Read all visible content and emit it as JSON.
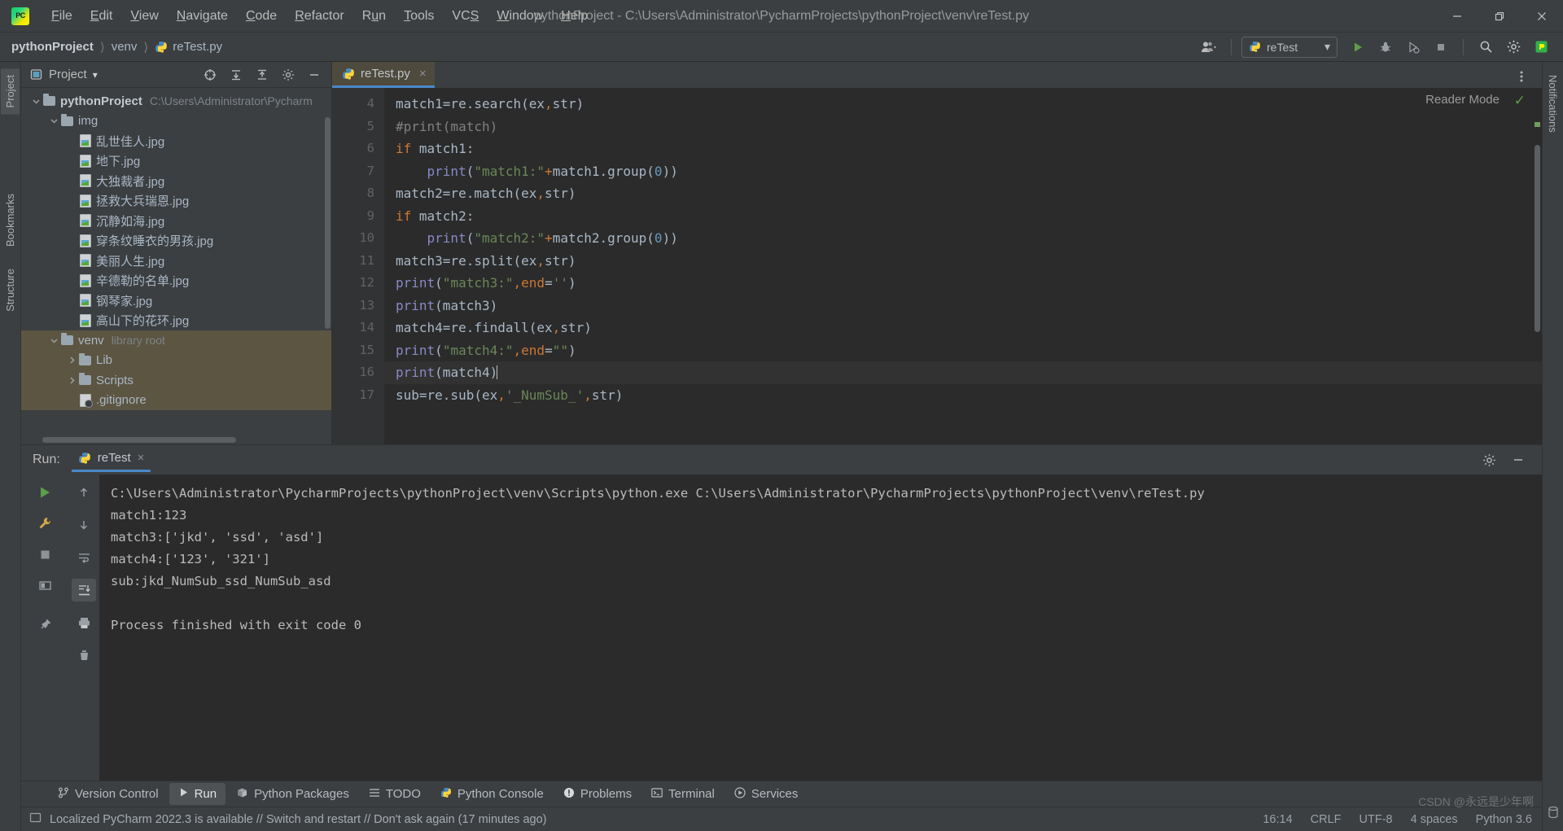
{
  "titlebar": {
    "logo_text": "PC",
    "window_title": "pythonProject - C:\\Users\\Administrator\\PycharmProjects\\pythonProject\\venv\\reTest.py",
    "menu": [
      {
        "label": "File",
        "mnemonic": "F"
      },
      {
        "label": "Edit",
        "mnemonic": "E"
      },
      {
        "label": "View",
        "mnemonic": "V"
      },
      {
        "label": "Navigate",
        "mnemonic": "N"
      },
      {
        "label": "Code",
        "mnemonic": "C"
      },
      {
        "label": "Refactor",
        "mnemonic": "R"
      },
      {
        "label": "Run",
        "mnemonic": "u"
      },
      {
        "label": "Tools",
        "mnemonic": "T"
      },
      {
        "label": "VCS",
        "mnemonic": "S"
      },
      {
        "label": "Window",
        "mnemonic": "W"
      },
      {
        "label": "Help",
        "mnemonic": "H"
      }
    ],
    "controls": {
      "minimize": "minimize-icon",
      "maximize": "restore-icon",
      "close": "close-icon"
    }
  },
  "navbar": {
    "breadcrumb": [
      {
        "label": "pythonProject",
        "bold": true
      },
      {
        "label": "venv",
        "bold": false
      },
      {
        "label": "reTest.py",
        "bold": false,
        "icon": "python-file-icon"
      }
    ],
    "separator": "〉",
    "run_config": {
      "label": "reTest",
      "icon": "python-icon",
      "chevron": "▾"
    },
    "buttons": [
      {
        "name": "run-button",
        "icon": "play-icon",
        "color": "#5c9f4a"
      },
      {
        "name": "debug-button",
        "icon": "bug-icon"
      },
      {
        "name": "run-with-coverage-button",
        "icon": "coverage-icon"
      },
      {
        "name": "stop-button",
        "icon": "stop-icon"
      },
      {
        "name": "search-everywhere-button",
        "icon": "search-icon"
      },
      {
        "name": "settings-button",
        "icon": "gear-icon"
      },
      {
        "name": "ide-assistant-button",
        "icon": "pycharm-badge-icon"
      }
    ],
    "account_icon": "user-account-icon"
  },
  "left_strip": {
    "tabs": [
      {
        "label": "Project",
        "active": true
      },
      {
        "label": "Bookmarks",
        "active": false
      },
      {
        "label": "Structure",
        "active": false
      }
    ]
  },
  "right_strip": {
    "tabs": [
      {
        "label": "Notifications",
        "active": false
      }
    ]
  },
  "project_panel": {
    "title": "Project",
    "title_icon": "project-icon",
    "chevron": "▾",
    "header_icons": [
      {
        "name": "select-opened-file-icon",
        "glyph": "⊕"
      },
      {
        "name": "expand-all-icon",
        "glyph": "⤓"
      },
      {
        "name": "collapse-all-icon",
        "glyph": "⤒"
      },
      {
        "name": "panel-settings-icon",
        "glyph": "⚙"
      },
      {
        "name": "hide-panel-icon",
        "glyph": "−"
      }
    ],
    "tree": [
      {
        "label": "pythonProject",
        "hint": "C:\\Users\\Administrator\\Pycharm",
        "indent": 0,
        "type": "folder",
        "arrow": "down",
        "bold": true,
        "selected": false
      },
      {
        "label": "img",
        "hint": "",
        "indent": 1,
        "type": "folder",
        "arrow": "down",
        "bold": false,
        "selected": false
      },
      {
        "label": "乱世佳人.jpg",
        "hint": "",
        "indent": 2,
        "type": "image",
        "arrow": "",
        "bold": false,
        "selected": false
      },
      {
        "label": "地下.jpg",
        "hint": "",
        "indent": 2,
        "type": "image",
        "arrow": "",
        "bold": false,
        "selected": false
      },
      {
        "label": "大独裁者.jpg",
        "hint": "",
        "indent": 2,
        "type": "image",
        "arrow": "",
        "bold": false,
        "selected": false
      },
      {
        "label": "拯救大兵瑞恩.jpg",
        "hint": "",
        "indent": 2,
        "type": "image",
        "arrow": "",
        "bold": false,
        "selected": false
      },
      {
        "label": "沉静如海.jpg",
        "hint": "",
        "indent": 2,
        "type": "image",
        "arrow": "",
        "bold": false,
        "selected": false
      },
      {
        "label": "穿条纹睡衣的男孩.jpg",
        "hint": "",
        "indent": 2,
        "type": "image",
        "arrow": "",
        "bold": false,
        "selected": false
      },
      {
        "label": "美丽人生.jpg",
        "hint": "",
        "indent": 2,
        "type": "image",
        "arrow": "",
        "bold": false,
        "selected": false
      },
      {
        "label": "辛德勒的名单.jpg",
        "hint": "",
        "indent": 2,
        "type": "image",
        "arrow": "",
        "bold": false,
        "selected": false
      },
      {
        "label": "钢琴家.jpg",
        "hint": "",
        "indent": 2,
        "type": "image",
        "arrow": "",
        "bold": false,
        "selected": false
      },
      {
        "label": "高山下的花环.jpg",
        "hint": "",
        "indent": 2,
        "type": "image",
        "arrow": "",
        "bold": false,
        "selected": false
      },
      {
        "label": "venv",
        "hint": "library root",
        "indent": 1,
        "type": "folder",
        "arrow": "down",
        "bold": false,
        "selected": true
      },
      {
        "label": "Lib",
        "hint": "",
        "indent": 2,
        "type": "folder",
        "arrow": "right",
        "bold": false,
        "selected": true
      },
      {
        "label": "Scripts",
        "hint": "",
        "indent": 2,
        "type": "folder",
        "arrow": "right",
        "bold": false,
        "selected": true
      },
      {
        "label": ".gitignore",
        "hint": "",
        "indent": 2,
        "type": "gitignore",
        "arrow": "",
        "bold": false,
        "selected": true
      }
    ]
  },
  "editor": {
    "tab": {
      "label": "reTest.py",
      "icon": "python-file-icon",
      "close": "×"
    },
    "tab_right_icon": "more-options-icon",
    "reader_mode": "Reader Mode",
    "reader_check": "✓",
    "first_line_number": 4,
    "current_line": 16,
    "lines": [
      {
        "n": 4,
        "text": "match1=re.search(ex,str)"
      },
      {
        "n": 5,
        "text": "#print(match)"
      },
      {
        "n": 6,
        "text": "if match1:"
      },
      {
        "n": 7,
        "text": "    print(\"match1:\"+match1.group(0))"
      },
      {
        "n": 8,
        "text": "match2=re.match(ex,str)"
      },
      {
        "n": 9,
        "text": "if match2:"
      },
      {
        "n": 10,
        "text": "    print(\"match2:\"+match2.group(0))"
      },
      {
        "n": 11,
        "text": "match3=re.split(ex,str)"
      },
      {
        "n": 12,
        "text": "print(\"match3:\",end='')"
      },
      {
        "n": 13,
        "text": "print(match3)"
      },
      {
        "n": 14,
        "text": "match4=re.findall(ex,str)"
      },
      {
        "n": 15,
        "text": "print(\"match4:\",end=\"\")"
      },
      {
        "n": 16,
        "text": "print(match4)"
      },
      {
        "n": 17,
        "text": "sub=re.sub(ex,'_NumSub_',str)"
      }
    ]
  },
  "run_panel": {
    "label": "Run:",
    "tab": {
      "label": "reTest",
      "icon": "python-icon",
      "close": "×"
    },
    "header_icons": [
      {
        "name": "run-settings-icon",
        "glyph": "⚙"
      },
      {
        "name": "hide-run-panel-icon",
        "glyph": "−"
      }
    ],
    "sidebar_icons": [
      {
        "name": "rerun-icon",
        "glyph": "▶",
        "color": "#5c9f4a"
      },
      {
        "name": "wrench-icon",
        "glyph": "🔧"
      },
      {
        "name": "stop-run-icon",
        "glyph": "■"
      },
      {
        "name": "pin-tab-icon",
        "glyph": "▣"
      }
    ],
    "sidebar2_icons": [
      {
        "name": "scroll-up-icon",
        "glyph": "↑"
      },
      {
        "name": "scroll-down-icon",
        "glyph": "↓"
      },
      {
        "name": "soft-wrap-icon",
        "glyph": "↵"
      },
      {
        "name": "scroll-to-end-icon",
        "glyph": "↧",
        "selected": true
      },
      {
        "name": "print-icon",
        "glyph": "⎙"
      },
      {
        "name": "clear-all-icon",
        "glyph": "🗑"
      }
    ],
    "console_lines": [
      "C:\\Users\\Administrator\\PycharmProjects\\pythonProject\\venv\\Scripts\\python.exe C:\\Users\\Administrator\\PycharmProjects\\pythonProject\\venv\\reTest.py",
      "match1:123",
      "match3:['jkd', 'ssd', 'asd']",
      "match4:['123', '321']",
      "sub:jkd_NumSub_ssd_NumSub_asd",
      "",
      "Process finished with exit code 0"
    ]
  },
  "bottom_tabs": [
    {
      "label": "Version Control",
      "icon": "branch-icon",
      "active": false
    },
    {
      "label": "Run",
      "icon": "play-icon",
      "active": true
    },
    {
      "label": "Python Packages",
      "icon": "packages-icon",
      "active": false
    },
    {
      "label": "TODO",
      "icon": "todo-icon",
      "active": false
    },
    {
      "label": "Python Console",
      "icon": "python-icon",
      "active": false
    },
    {
      "label": "Problems",
      "icon": "problems-icon",
      "active": false
    },
    {
      "label": "Terminal",
      "icon": "terminal-icon",
      "active": false
    },
    {
      "label": "Services",
      "icon": "services-icon",
      "active": false
    }
  ],
  "statusbar": {
    "event_icon": "event-log-icon",
    "message": "Localized PyCharm 2022.3 is available // Switch and restart // Don't ask again (17 minutes ago)",
    "time": "16:14",
    "line_separator": "CRLF",
    "encoding": "UTF-8",
    "indent": "4 spaces",
    "interpreter": "Python 3.6",
    "watermark": "CSDN @永远是少年啊"
  },
  "colors": {
    "bg": "#3c3f41",
    "editor_bg": "#2b2b2b",
    "gutter_bg": "#313335",
    "accent": "#4a88c7",
    "selection": "#5c5542",
    "keyword": "#cc7832",
    "string": "#6a8759",
    "number": "#6897bb",
    "comment": "#808080",
    "function": "#8888c6",
    "text": "#a9b7c6"
  }
}
